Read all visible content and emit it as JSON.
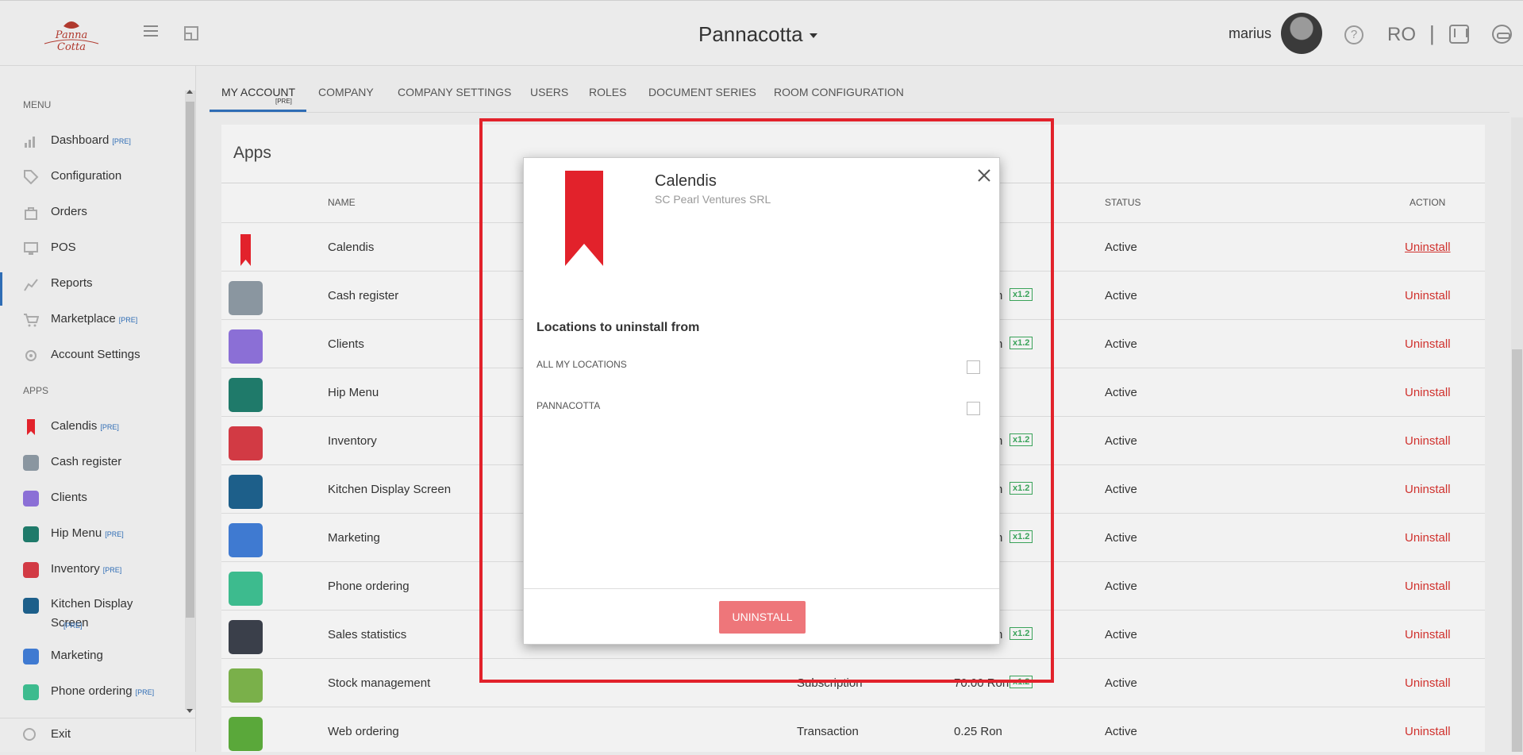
{
  "header": {
    "logo_text": "Panna Cotta",
    "company": "Pannacotta",
    "username": "marius",
    "language": "RO",
    "separator": "|"
  },
  "sidebar": {
    "menu_title": "MENU",
    "apps_title": "APPS",
    "pre_tag": "[PRE]",
    "menu_items": [
      {
        "label": "Dashboard",
        "pre": true,
        "icon": "dashboard-icon"
      },
      {
        "label": "Configuration",
        "pre": false,
        "icon": "tag-icon"
      },
      {
        "label": "Orders",
        "pre": false,
        "icon": "bag-icon"
      },
      {
        "label": "POS",
        "pre": false,
        "icon": "monitor-icon"
      },
      {
        "label": "Reports",
        "pre": false,
        "icon": "chart-icon"
      },
      {
        "label": "Marketplace",
        "pre": true,
        "icon": "cart-icon"
      },
      {
        "label": "Account Settings",
        "pre": false,
        "icon": "gear-icon"
      }
    ],
    "app_items": [
      {
        "label": "Calendis",
        "pre": true
      },
      {
        "label": "Cash register",
        "pre": false
      },
      {
        "label": "Clients",
        "pre": false
      },
      {
        "label": "Hip Menu",
        "pre": true
      },
      {
        "label": "Inventory",
        "pre": true
      },
      {
        "label": "Kitchen Display Screen",
        "pre": true
      },
      {
        "label": "Marketing",
        "pre": false
      },
      {
        "label": "Phone ordering",
        "pre": true
      }
    ],
    "exit_label": "Exit"
  },
  "tabs": [
    {
      "label": "MY ACCOUNT",
      "active": true
    },
    {
      "label": "COMPANY"
    },
    {
      "label": "COMPANY SETTINGS"
    },
    {
      "label": "USERS"
    },
    {
      "label": "ROLES"
    },
    {
      "label": "DOCUMENT SERIES"
    },
    {
      "label": "ROOM CONFIGURATION"
    }
  ],
  "tab_pre": "[PRE]",
  "apps_panel": {
    "title": "Apps",
    "columns": {
      "name": "NAME",
      "status": "STATUS",
      "action": "ACTION"
    },
    "rows": [
      {
        "name": "Calendis",
        "type": "",
        "price": "",
        "badge": "",
        "status": "Active",
        "action": "Uninstall",
        "color": "#e2222b"
      },
      {
        "name": "Cash register",
        "type": "",
        "price": "n",
        "badge": "x1.2",
        "status": "Active",
        "action": "Uninstall",
        "color": "#8a96a0"
      },
      {
        "name": "Clients",
        "type": "",
        "price": "n",
        "badge": "x1.2",
        "status": "Active",
        "action": "Uninstall",
        "color": "#8b6fd6"
      },
      {
        "name": "Hip Menu",
        "type": "",
        "price": "",
        "badge": "",
        "status": "Active",
        "action": "Uninstall",
        "color": "#1f7a6a"
      },
      {
        "name": "Inventory",
        "type": "",
        "price": "n",
        "badge": "x1.2",
        "status": "Active",
        "action": "Uninstall",
        "color": "#d23a44"
      },
      {
        "name": "Kitchen Display Screen",
        "type": "",
        "price": "n",
        "badge": "x1.2",
        "status": "Active",
        "action": "Uninstall",
        "color": "#1d5f8a"
      },
      {
        "name": "Marketing",
        "type": "",
        "price": "n",
        "badge": "x1.2",
        "status": "Active",
        "action": "Uninstall",
        "color": "#3f7ad1"
      },
      {
        "name": "Phone ordering",
        "type": "",
        "price": "",
        "badge": "",
        "status": "Active",
        "action": "Uninstall",
        "color": "#3dbb8e"
      },
      {
        "name": "Sales statistics",
        "type": "",
        "price": "n",
        "badge": "x1.2",
        "status": "Active",
        "action": "Uninstall",
        "color": "#3a3f4a"
      },
      {
        "name": "Stock management",
        "type": "Subscription",
        "price": "70.00 Ron",
        "badge": "x1.2",
        "status": "Active",
        "action": "Uninstall",
        "color": "#7ab04a"
      },
      {
        "name": "Web ordering",
        "type": "Transaction",
        "price": "0.25 Ron",
        "badge": "",
        "status": "Active",
        "action": "Uninstall",
        "color": "#5aa83a"
      }
    ]
  },
  "modal": {
    "app_name": "Calendis",
    "vendor": "SC Pearl Ventures SRL",
    "heading": "Locations to uninstall from",
    "options": [
      "ALL MY LOCATIONS",
      "PANNACOTTA"
    ],
    "button": "UNINSTALL"
  },
  "colors": {
    "accent": "#2f6db5",
    "danger": "#d0312d",
    "highlight_frame": "#e2222b"
  }
}
